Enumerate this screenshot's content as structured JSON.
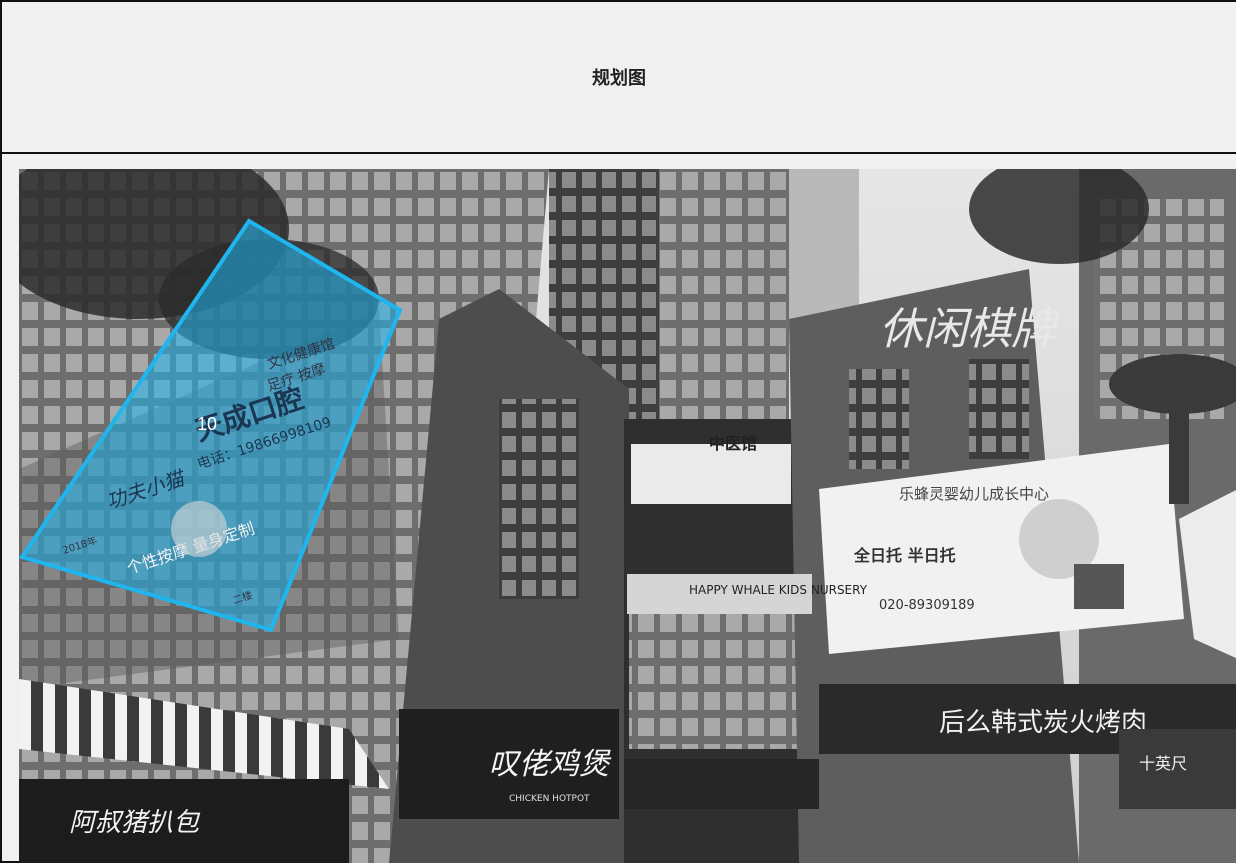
{
  "header": {
    "title": "规划图"
  },
  "photo": {
    "region_label": "10",
    "highlight_color": "#1fb5ef",
    "signs": {
      "culture_title": "文化健康馆",
      "culture_services": "足疗 按摩",
      "clinic_name": "天成口腔",
      "clinic_phone": "电话：19866998109",
      "massage_brand": "功夫小猫",
      "massage_slogan": "个性按摩 量身定制",
      "year_tag": "2018年",
      "floor_tag": "二楼",
      "restaurant_chicken": "叹佬鸡煲",
      "restaurant_chicken_en": "CHICKEN HOTPOT",
      "restaurant_bbq": "后么韩式炭火烤肉",
      "restaurant_pig": "阿叔猪扒包",
      "restaurant_chinese": "中医馆",
      "shop_chess": "休闲棋牌",
      "kindergarten": "乐蜂灵婴幼儿成长中心",
      "kindergarten_en": "HAPPY WHALE KIDS NURSERY",
      "kindergarten_plans": "全日托 半日托",
      "kindergarten_phone": "020-89309189",
      "right_clinic": "天成口腔",
      "right_sign": "十英尺"
    }
  }
}
